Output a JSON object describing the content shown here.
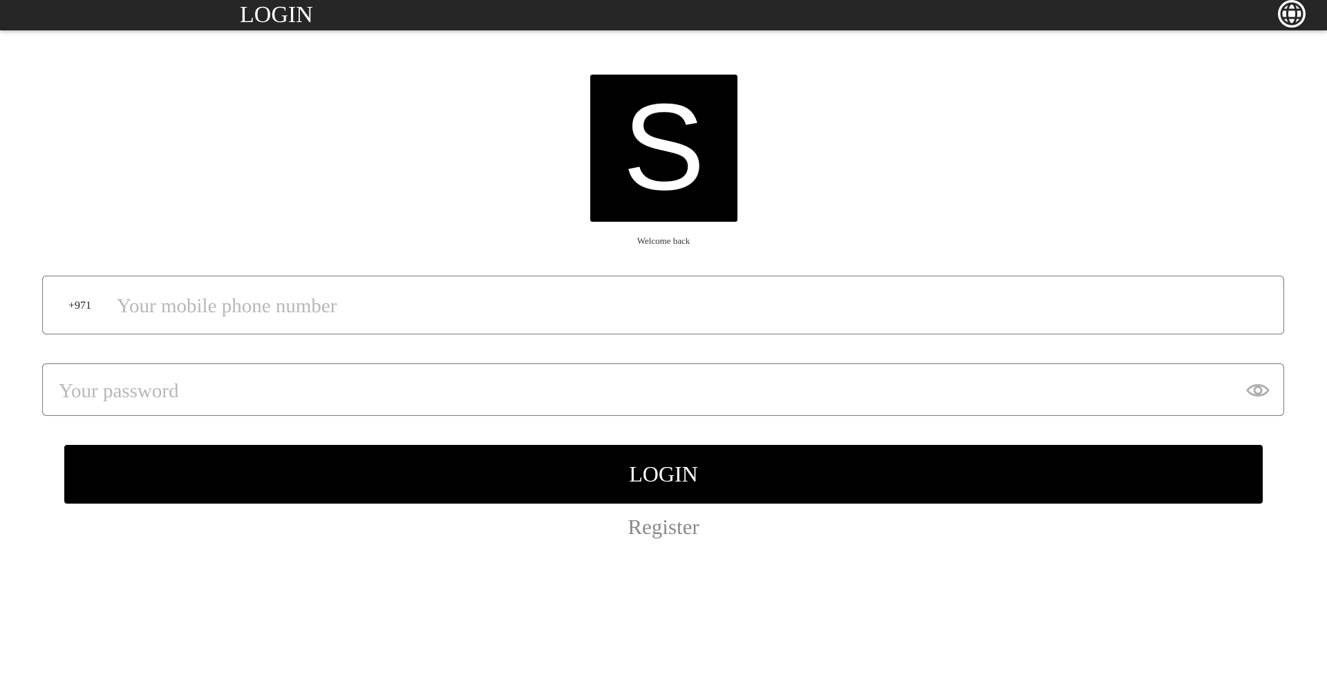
{
  "header": {
    "title": "LOGIN",
    "language_icon": "globe-icon",
    "background_color": "#262626"
  },
  "logo": {
    "letter": "S",
    "background_color": "#000000"
  },
  "welcome_text": "Welcome back",
  "phone_field": {
    "country_code": "+971",
    "placeholder": "Your mobile phone number",
    "value": ""
  },
  "password_field": {
    "placeholder": "Your password",
    "value": "",
    "toggle_icon": "eye-icon"
  },
  "login_button": {
    "label": "LOGIN",
    "background_color": "#000000"
  },
  "register_link": {
    "label": "Register"
  }
}
